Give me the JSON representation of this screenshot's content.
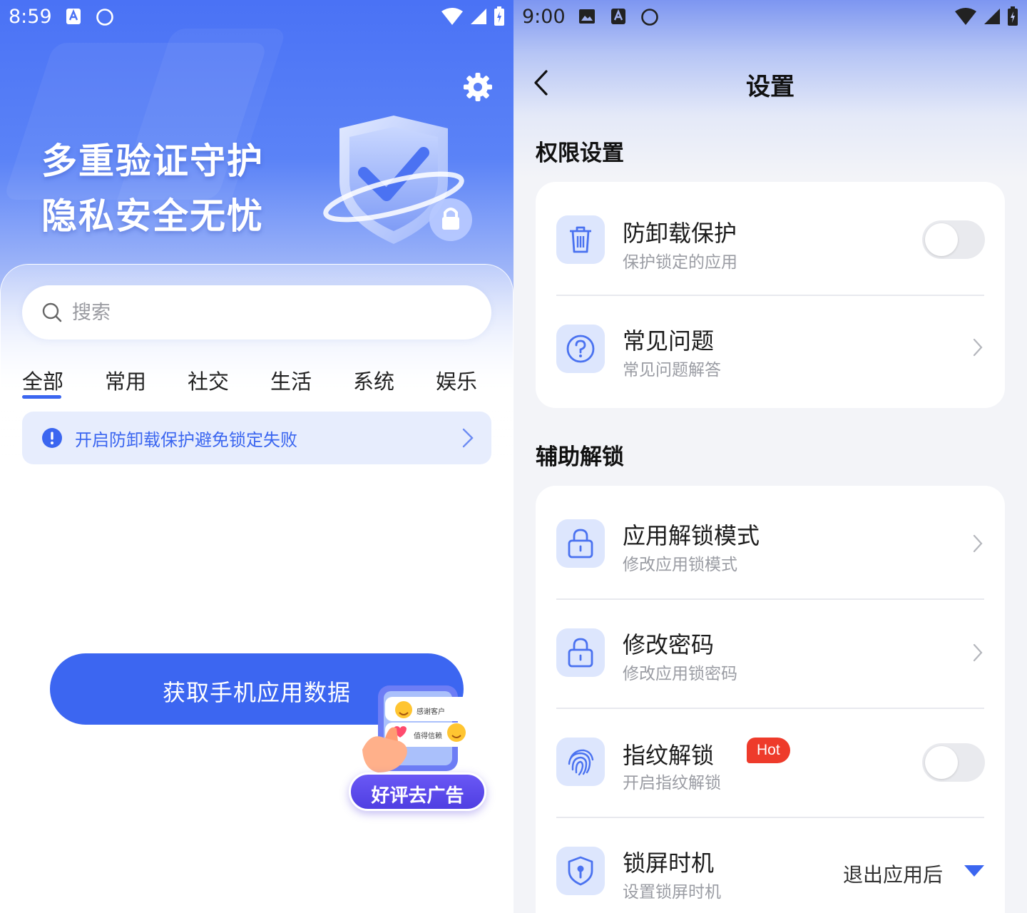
{
  "left": {
    "status_bar": {
      "time": "8:59"
    },
    "hero": {
      "line1": "多重验证守护",
      "line2": "隐私安全无忧"
    },
    "search": {
      "placeholder": "搜索"
    },
    "tabs": [
      "全部",
      "常用",
      "社交",
      "生活",
      "系统",
      "娱乐"
    ],
    "active_tab": "全部",
    "notice": {
      "text": "开启防卸载保护避免锁定失败"
    },
    "main_button": {
      "label": "获取手机应用数据"
    },
    "ad": {
      "label": "好评去广告",
      "bubble1": "感谢客户",
      "bubble2": "值得信赖"
    },
    "colors": {
      "accent": "#3c66f1",
      "hero_top": "#4a72f5",
      "notice_bg": "#e7edfd"
    }
  },
  "right": {
    "status_bar": {
      "time": "9:00"
    },
    "title": "设置",
    "sections": [
      {
        "title": "权限设置",
        "rows": [
          {
            "icon": "trash-icon",
            "title": "防卸载保护",
            "subtitle": "保护锁定的应用",
            "control": "toggle",
            "checked": false
          },
          {
            "icon": "question-icon",
            "title": "常见问题",
            "subtitle": "常见问题解答",
            "control": "chevron"
          }
        ]
      },
      {
        "title": "辅助解锁",
        "rows": [
          {
            "icon": "lock-icon",
            "title": "应用解锁模式",
            "subtitle": "修改应用锁模式",
            "control": "chevron"
          },
          {
            "icon": "lock-icon",
            "title": "修改密码",
            "subtitle": "修改应用锁密码",
            "control": "chevron"
          },
          {
            "icon": "fingerprint-icon",
            "title": "指纹解锁",
            "badge": "Hot",
            "subtitle": "开启指纹解锁",
            "control": "toggle",
            "checked": false
          },
          {
            "icon": "shield-key-icon",
            "title": "锁屏时机",
            "subtitle": "设置锁屏时机",
            "control": "dropdown",
            "value": "退出应用后"
          }
        ]
      }
    ],
    "colors": {
      "icon_bg": "#dde6fd",
      "icon_fg": "#4a72f0",
      "hot_badge": "#ee3b2b"
    }
  }
}
